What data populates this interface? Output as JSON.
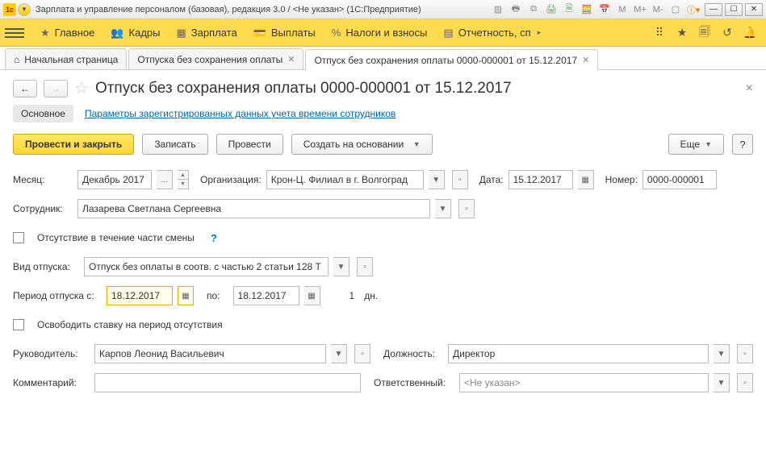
{
  "titlebar": {
    "app_title": "Зарплата и управление персоналом (базовая), редакция 3.0 / <Не указан>  (1С:Предприятие)"
  },
  "mainnav": {
    "items": [
      {
        "label": "Главное"
      },
      {
        "label": "Кадры"
      },
      {
        "label": "Зарплата"
      },
      {
        "label": "Выплаты"
      },
      {
        "label": "Налоги и взносы"
      },
      {
        "label": "Отчетность, сп"
      }
    ]
  },
  "tabs": [
    {
      "label": "Начальная страница",
      "home": true,
      "closable": false
    },
    {
      "label": "Отпуска без сохранения оплаты",
      "closable": true
    },
    {
      "label": "Отпуск без сохранения оплаты 0000-000001 от 15.12.2017",
      "closable": true,
      "active": true
    }
  ],
  "doc": {
    "title": "Отпуск без сохранения оплаты 0000-000001 от 15.12.2017",
    "sublinks": {
      "main": "Основное",
      "params": "Параметры зарегистрированных данных учета времени сотрудников"
    },
    "actions": {
      "post_close": "Провести и закрыть",
      "save": "Записать",
      "post": "Провести",
      "create_based": "Создать на основании",
      "more": "Еще",
      "help": "?"
    },
    "form": {
      "month_label": "Месяц:",
      "month_value": "Декабрь 2017",
      "org_label": "Организация:",
      "org_value": "Крон-Ц. Филиал в г. Волгоград",
      "date_label": "Дата:",
      "date_value": "15.12.2017",
      "number_label": "Номер:",
      "number_value": "0000-000001",
      "employee_label": "Сотрудник:",
      "employee_value": "Лазарева Светлана Сергеевна",
      "partial_shift": "Отсутствие в течение части смены",
      "leave_type_label": "Вид отпуска:",
      "leave_type_value": "Отпуск без оплаты в соотв. с частью 2 статьи 128 Т",
      "period_label": "Период отпуска с:",
      "period_from": "18.12.2017",
      "period_to_label": "по:",
      "period_to": "18.12.2017",
      "days_count": "1",
      "days_unit": "дн.",
      "free_rate": "Освободить ставку на период отсутствия",
      "manager_label": "Руководитель:",
      "manager_value": "Карпов Леонид Васильевич",
      "position_label": "Должность:",
      "position_value": "Директор",
      "comment_label": "Комментарий:",
      "comment_value": "",
      "responsible_label": "Ответственный:",
      "responsible_value": "<Не указан>"
    }
  }
}
